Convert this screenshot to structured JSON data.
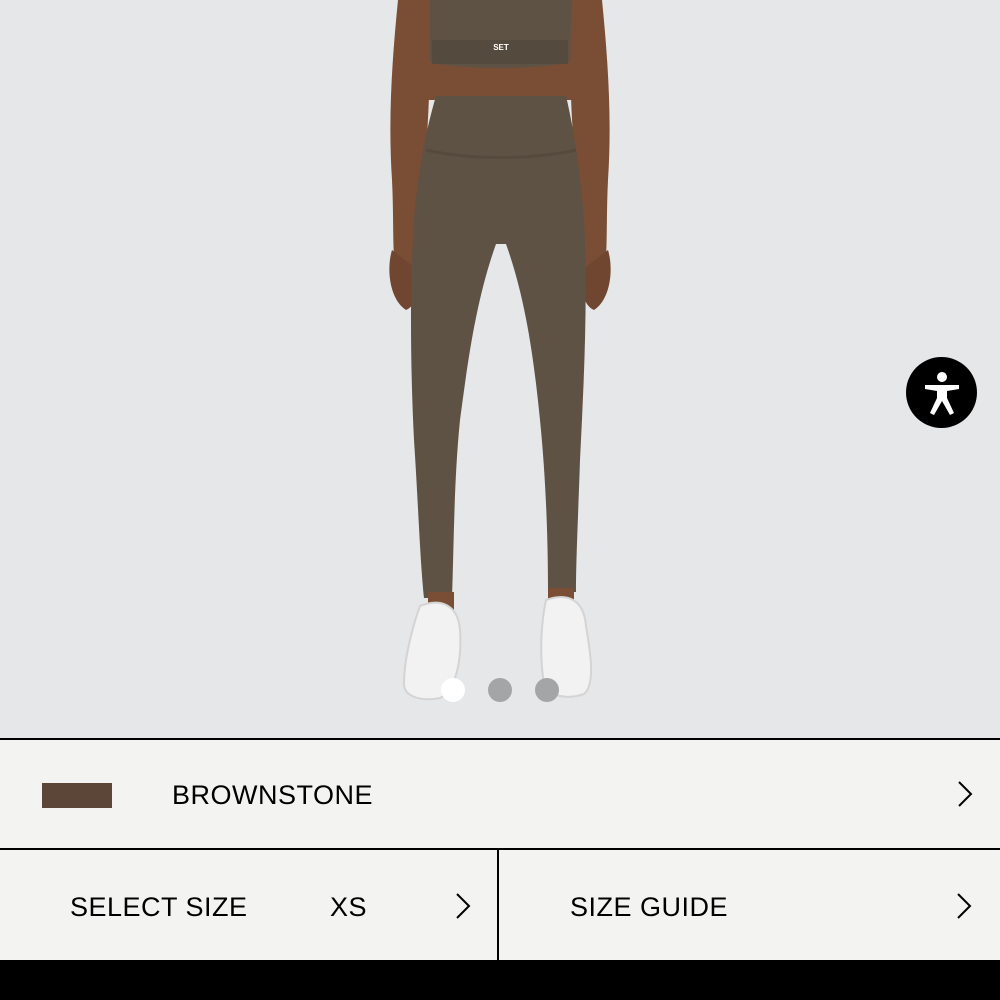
{
  "product": {
    "image_alt": "Model wearing brownstone sports bra and leggings with white sneakers",
    "bra_logo_text": "SET"
  },
  "carousel": {
    "count": 3,
    "active_index": 0
  },
  "accessibility": {
    "icon": "accessibility-icon"
  },
  "color": {
    "name": "BROWNSTONE",
    "swatch": "#5b4638"
  },
  "size": {
    "label": "SELECT SIZE",
    "value": "XS"
  },
  "size_guide": {
    "label": "SIZE GUIDE"
  },
  "colors": {
    "garment": "#5e5244",
    "skin": "#7a4e35",
    "background": "#e6e7e9"
  }
}
